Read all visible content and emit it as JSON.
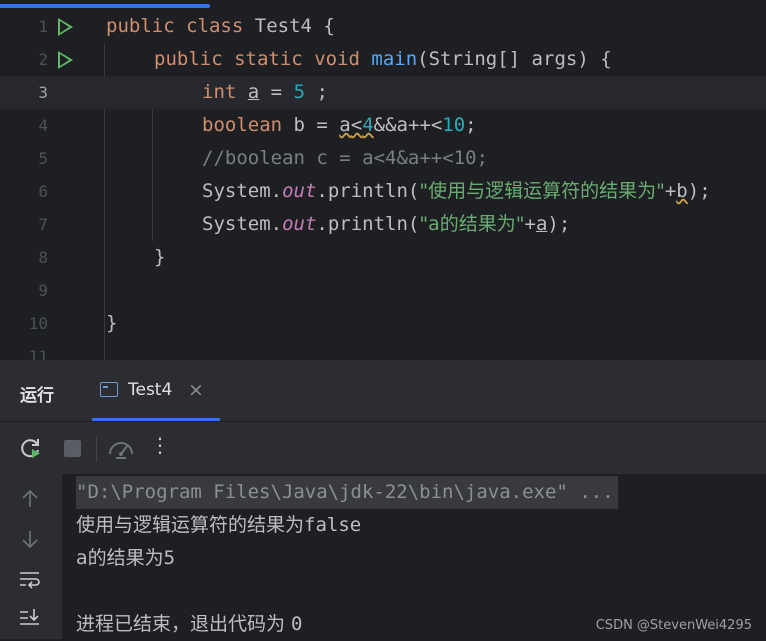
{
  "editor": {
    "line_numbers": [
      "1",
      "2",
      "3",
      "4",
      "5",
      "6",
      "7",
      "8",
      "9",
      "10",
      "11"
    ],
    "line1": {
      "kw1": "public",
      "kw2": "class",
      "name": "Test4",
      "brace": "{"
    },
    "line2": {
      "kw1": "public",
      "kw2": "static",
      "kw3": "void",
      "method": "main",
      "params": "(String[] args) {"
    },
    "line3": {
      "type": "int",
      "var": "a",
      "eq": " = ",
      "value": "5",
      "end": " ;"
    },
    "line4": {
      "type": "boolean",
      "decl": " b = ",
      "expr_a": "a",
      "lt1": "<",
      "n1": "4",
      "mid": "&&a++<",
      "n2": "10",
      "end": ";"
    },
    "line5": {
      "comment": "//boolean c = a<4&a++<10;"
    },
    "line6": {
      "obj": "System.",
      "field": "out",
      "call": ".println(",
      "str": "\"使用与逻辑运算符的结果为\"",
      "plus": "+",
      "var": "b",
      "end": ");"
    },
    "line7": {
      "obj": "System.",
      "field": "out",
      "call": ".println(",
      "str": "\"a的结果为\"",
      "plus": "+",
      "var": "a",
      "end": ");"
    },
    "line8": {
      "brace": "}"
    },
    "line10": {
      "brace": "}"
    }
  },
  "panel": {
    "title": "运行",
    "tab": {
      "label": "Test4",
      "close": "×"
    },
    "toolbar": {
      "more": "⋮"
    }
  },
  "console": {
    "cmd": "\"D:\\Program Files\\Java\\jdk-22\\bin\\java.exe\" ...",
    "out1_cn": "使用与逻辑运算符的结果为",
    "out1_val": "false",
    "out2_cn": "a的结果为",
    "out2_val": "5",
    "exit_cn": "进程已结束，退出代码为 ",
    "exit_val": "0"
  },
  "watermark": "CSDN @StevenWei4295",
  "colors": {
    "accent": "#3574f0",
    "run_green": "#5fb865",
    "keyword": "#cf8e6d",
    "string": "#6aab73",
    "number": "#2aacb8"
  }
}
